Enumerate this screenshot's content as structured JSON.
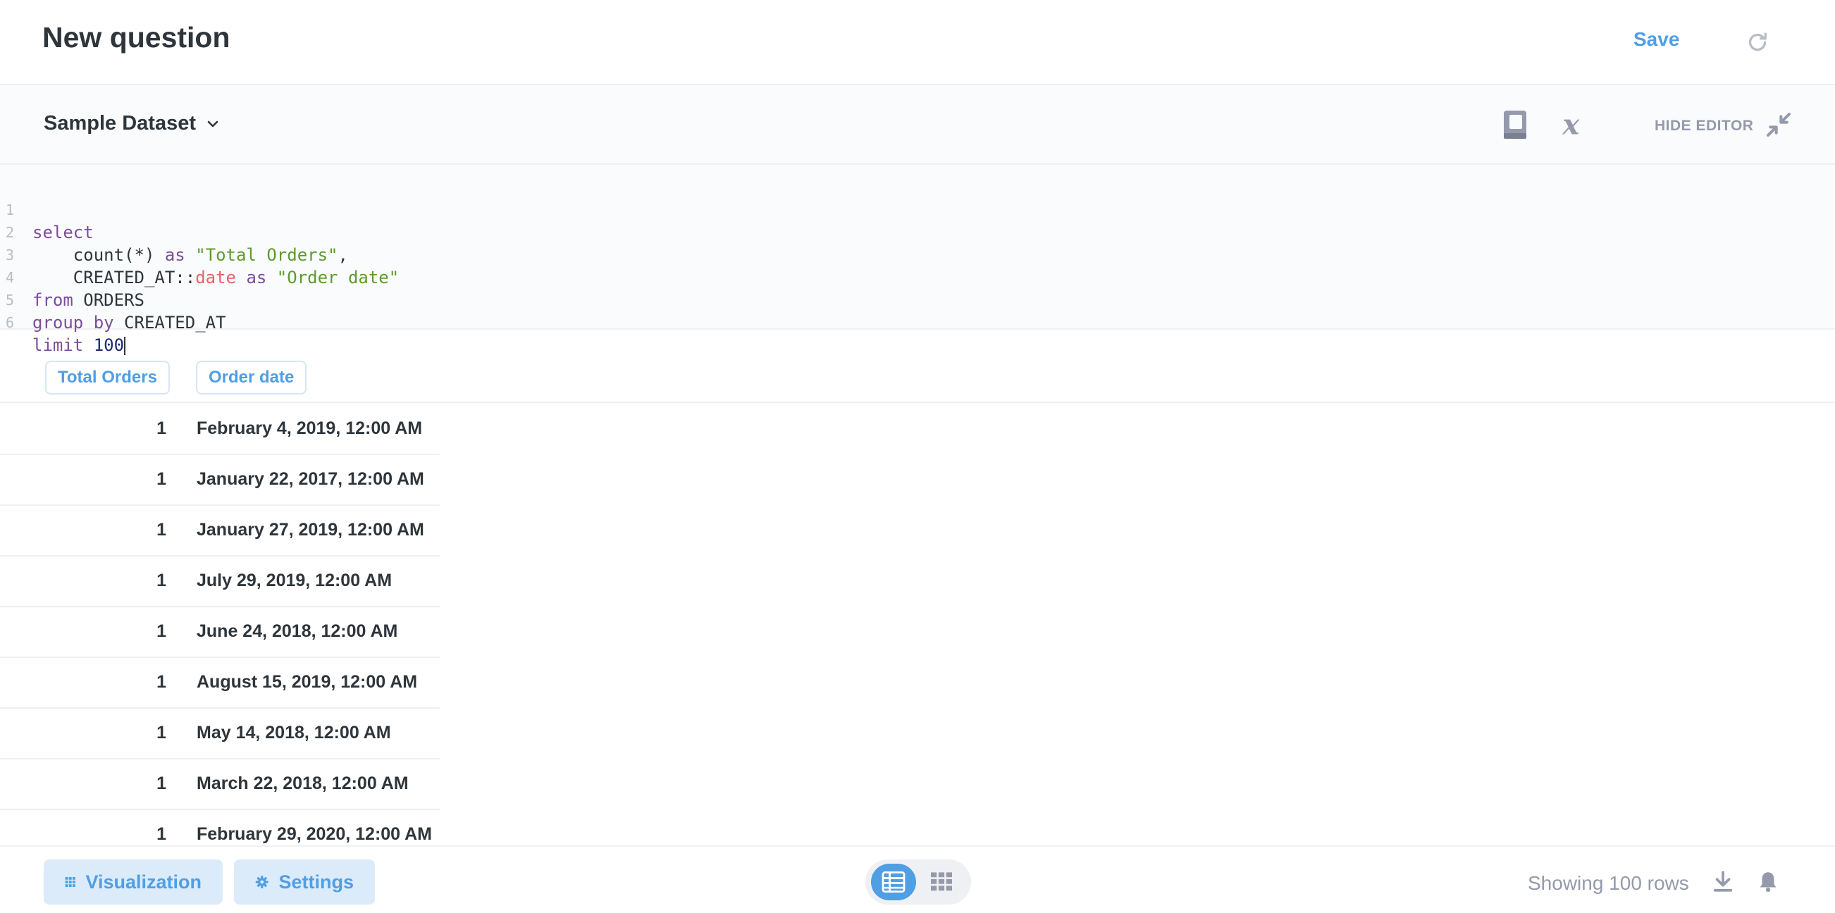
{
  "header": {
    "title": "New question",
    "save_label": "Save",
    "refresh_icon": "refresh-icon"
  },
  "toolbar": {
    "database": "Sample Dataset",
    "hide_editor_label": "HIDE EDITOR",
    "icons": [
      "reference-book-icon",
      "variable-icon",
      "contract-icon"
    ]
  },
  "editor": {
    "line_numbers": [
      "1",
      "2",
      "3",
      "4",
      "5",
      "6"
    ],
    "lines": [
      "select",
      "    count(*) as \"Total Orders\",",
      "    CREATED_AT::date as \"Order date\"",
      "from ORDERS",
      "group by CREATED_AT",
      "limit 100"
    ]
  },
  "table": {
    "columns": [
      "Total Orders",
      "Order date"
    ],
    "rows": [
      [
        "1",
        "February 4, 2019, 12:00 AM"
      ],
      [
        "1",
        "January 22, 2017, 12:00 AM"
      ],
      [
        "1",
        "January 27, 2019, 12:00 AM"
      ],
      [
        "1",
        "July 29, 2019, 12:00 AM"
      ],
      [
        "1",
        "June 24, 2018, 12:00 AM"
      ],
      [
        "1",
        "August 15, 2019, 12:00 AM"
      ],
      [
        "1",
        "May 14, 2018, 12:00 AM"
      ],
      [
        "1",
        "March 22, 2018, 12:00 AM"
      ],
      [
        "1",
        "February 29, 2020, 12:00 AM"
      ]
    ]
  },
  "footer": {
    "visualization_label": "Visualization",
    "settings_label": "Settings",
    "rows_text": "Showing 100 rows"
  },
  "colors": {
    "brand": "#509ee3",
    "text": "#2e353b",
    "muted": "#949aab"
  }
}
